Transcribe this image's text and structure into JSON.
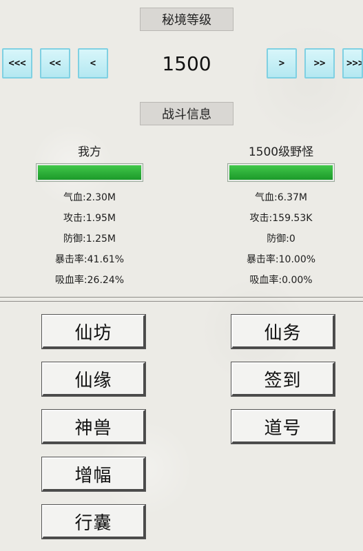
{
  "level_section": {
    "header": "秘境等级",
    "value": "1500",
    "nav": {
      "first": "<<<",
      "fast_prev": "<<",
      "prev": "<",
      "next": ">",
      "fast_next": ">>",
      "last": ">>>"
    }
  },
  "battle_section": {
    "header": "战斗信息",
    "player": {
      "title": "我方",
      "hp_fill_fraction": 1.0,
      "stats": {
        "hp": "气血:2.30M",
        "attack": "攻击:1.95M",
        "defense": "防御:1.25M",
        "crit": "暴击率:41.61%",
        "lifesteal": "吸血率:26.24%"
      }
    },
    "enemy": {
      "title": "1500级野怪",
      "hp_fill_fraction": 1.0,
      "stats": {
        "hp": "气血:6.37M",
        "attack": "攻击:159.53K",
        "defense": "防御:0",
        "crit": "暴击率:10.00%",
        "lifesteal": "吸血率:0.00%"
      }
    }
  },
  "menu": {
    "xianfang": "仙坊",
    "xianwu": "仙务",
    "xianyuan": "仙缘",
    "qiandao": "签到",
    "shenshou": "神兽",
    "daohao": "道号",
    "zengfu": "增幅",
    "xingnang": "行囊"
  },
  "colors": {
    "hp_bar": "#1c9a2a",
    "nav_button": "#b4e8f1",
    "background": "#ecebe6"
  }
}
